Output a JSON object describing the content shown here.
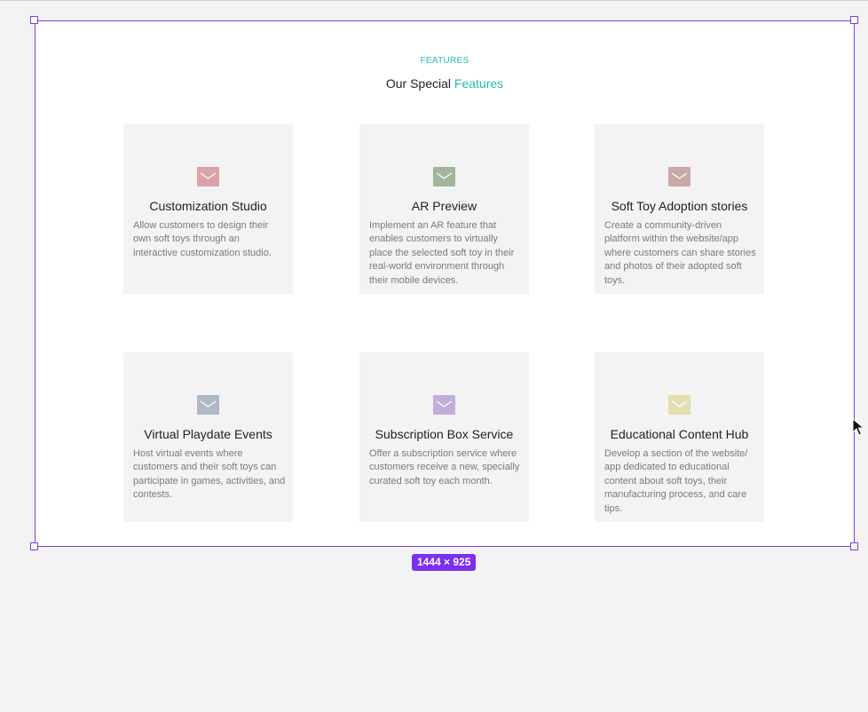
{
  "section": {
    "eyebrow": "FEATURES",
    "heading_prefix": "Our Special",
    "heading_accent": "Features",
    "accent_color": "#2cb8b0"
  },
  "frame": {
    "size_label": "1444 × 925",
    "selection_color": "#7b3fe4"
  },
  "features": [
    {
      "title": "Customization Studio",
      "description": "Allow customers to design their own soft toys through an interactive customization studio.",
      "icon": "mail-icon",
      "icon_color": "#dda1aa"
    },
    {
      "title": "AR Preview",
      "description": "Implement an AR feature that enables customers to virtually place the selected soft toy in their real-world environment through their mobile devices.",
      "icon": "mail-icon",
      "icon_color": "#a3b59c"
    },
    {
      "title": "Soft Toy Adoption stories",
      "description": "Create a community-driven platform within the website/app where customers can share stories and photos of their adopted soft toys.",
      "icon": "mail-icon",
      "icon_color": "#c8aaa6"
    },
    {
      "title": "Virtual Playdate Events",
      "description": "Host virtual events where customers and their soft toys can participate in games, activities, and contests.",
      "icon": "mail-icon",
      "icon_color": "#afb8c6"
    },
    {
      "title": "Subscription Box Service",
      "description": "Offer a subscription service where customers receive a new, specially curated soft toy each month.",
      "icon": "mail-icon",
      "icon_color": "#c3addc"
    },
    {
      "title": "Educational Content Hub",
      "description": "Develop a section of the website/ app dedicated to educational content about soft toys, their manufacturing process, and care tips.",
      "icon": "mail-icon",
      "icon_color": "#e3dfae"
    }
  ]
}
